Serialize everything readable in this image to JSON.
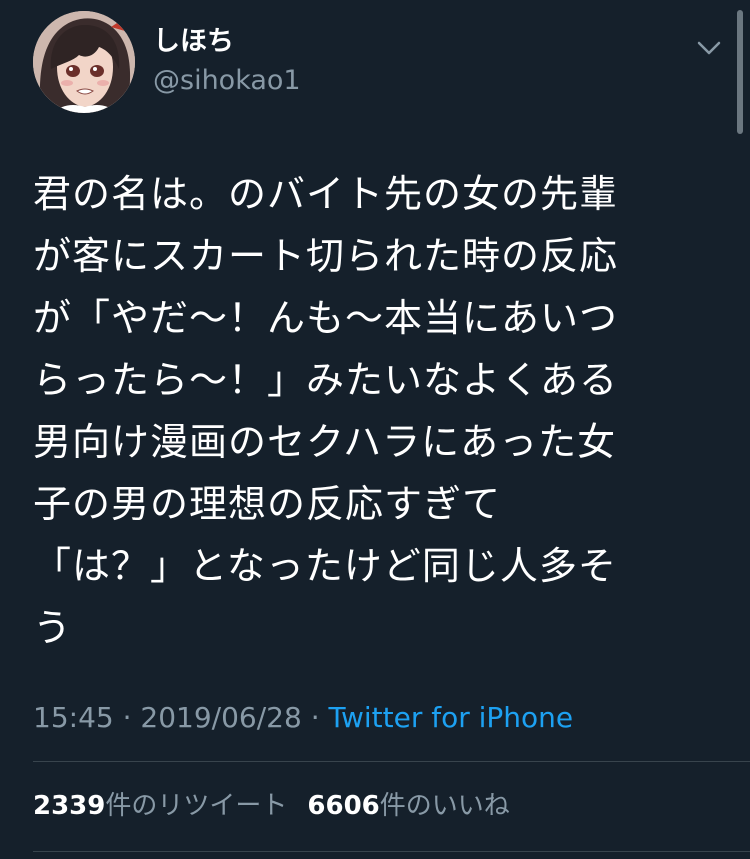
{
  "user": {
    "display_name": "しほち",
    "handle": "@sihokao1"
  },
  "tweet": {
    "lines": [
      "君の名は。のバイト先の女の先輩",
      "が客にスカート切られた時の反応",
      "が「やだ〜！んも〜本当にあいつ",
      "らったら〜！」みたいなよくある",
      "男向け漫画のセクハラにあった女",
      "子の男の理想の反応すぎて",
      "「は？」となったけど同じ人多そ",
      "う"
    ],
    "time": "15:45",
    "separator": " · ",
    "date": "2019/06/28",
    "source": "Twitter for iPhone"
  },
  "stats": {
    "retweets_count": "2339",
    "retweets_label": "件のリツイート",
    "likes_count": "6606",
    "likes_label": "件のいいね"
  },
  "colors": {
    "background": "#15202b",
    "text": "#ffffff",
    "secondary": "#8899a6",
    "link": "#1da1f2",
    "divider": "#38444d"
  },
  "icons": {
    "menu": "chevron-down-icon",
    "avatar": "anime-character-avatar"
  }
}
